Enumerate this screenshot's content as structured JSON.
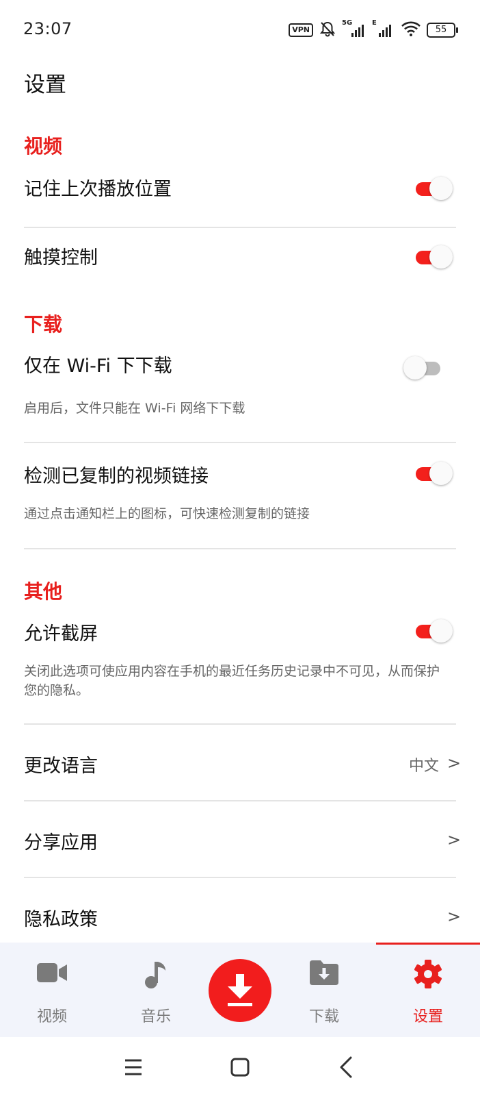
{
  "status_bar": {
    "time": "23:07",
    "vpn_label": "VPN",
    "signal_1_label": "5G",
    "signal_2_label": "E",
    "battery_level": "55"
  },
  "page": {
    "title": "设置"
  },
  "sections": {
    "video": {
      "header": "视频",
      "remember_position": {
        "title": "记住上次播放位置",
        "enabled": true
      },
      "touch_control": {
        "title": "触摸控制",
        "enabled": true
      }
    },
    "download": {
      "header": "下载",
      "wifi_only": {
        "title": "仅在 Wi-Fi 下下载",
        "description": "启用后，文件只能在 Wi-Fi 网络下下载",
        "enabled": false
      },
      "detect_links": {
        "title": "检测已复制的视频链接",
        "description": "通过点击通知栏上的图标，可快速检测复制的链接",
        "enabled": true
      }
    },
    "other": {
      "header": "其他",
      "allow_screenshot": {
        "title": "允许截屏",
        "description": "关闭此选项可使应用内容在手机的最近任务历史记录中不可见，从而保护您的隐私。",
        "enabled": true
      },
      "change_language": {
        "title": "更改语言",
        "value": "中文"
      },
      "share_app": {
        "title": "分享应用"
      },
      "privacy_policy": {
        "title": "隐私政策"
      }
    }
  },
  "chevron_glyph": ">",
  "bottom_nav": {
    "items": [
      {
        "label": "视频",
        "icon": "video-camera-icon"
      },
      {
        "label": "音乐",
        "icon": "music-note-icon"
      },
      {
        "label": "下载",
        "icon": "download-folder-icon"
      },
      {
        "label": "设置",
        "icon": "gear-icon"
      }
    ],
    "fab_icon": "download-arrow-icon",
    "active": "设置"
  },
  "colors": {
    "accent": "#e8201e",
    "toggle_on": "#f3201c",
    "toggle_off": "#bdbdbd",
    "nav_background": "#f2f4fb"
  }
}
